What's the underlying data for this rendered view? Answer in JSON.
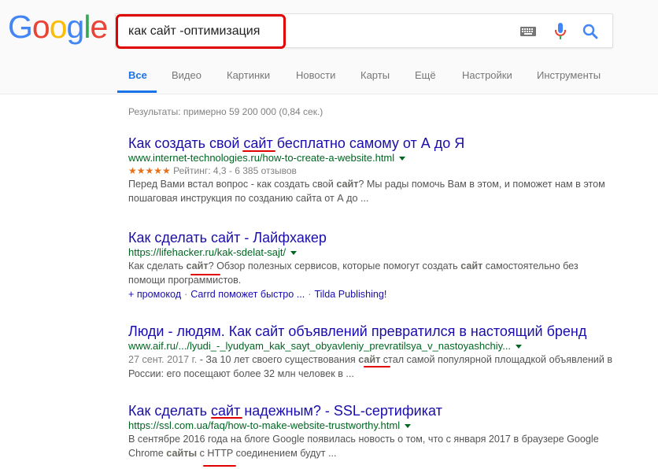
{
  "logo": {
    "letters": [
      "G",
      "o",
      "o",
      "g",
      "l",
      "e"
    ]
  },
  "search": {
    "query": "как сайт -оптимизация"
  },
  "icons": {
    "keyboard": "keyboard-icon",
    "mic": "microphone-icon",
    "search": "search-icon"
  },
  "tabs": [
    {
      "label": "Все",
      "active": true
    },
    {
      "label": "Видео"
    },
    {
      "label": "Картинки"
    },
    {
      "label": "Новости"
    },
    {
      "label": "Карты"
    },
    {
      "label": "Ещё"
    },
    {
      "label": "Настройки"
    },
    {
      "label": "Инструменты"
    }
  ],
  "stats": "Результаты: примерно 59 200 000 (0,84 сек.)",
  "results": [
    {
      "title_parts": [
        "Как создать свой ",
        "сайт",
        " бесплатно самому от А до Я"
      ],
      "url": "www.internet-technologies.ru/how-to-create-a-website.html",
      "rating": {
        "stars": "★★★★★",
        "text": "Рейтинг: 4,3 - 6 385 отзывов",
        "value": 4.3
      },
      "snippet_parts": [
        "Перед Вами встал вопрос - как создать свой ",
        "сайт",
        "? Мы рады помочь Вам в этом, и поможет нам в этом пошаговая инструкция по созданию сайта от А до ..."
      ]
    },
    {
      "title": "Как сделать сайт - Лайфхакер",
      "url": "https://lifehacker.ru/kak-sdelat-sajt/",
      "snippet_parts": [
        "Как сделать ",
        "сайт",
        "? Обзор полезных сервисов, которые помогут создать ",
        "сайт",
        " самостоятельно без помощи программистов."
      ],
      "sitelinks": [
        "+ промокод",
        "Carrd поможет быстро ...",
        "Tilda Publishing!"
      ]
    },
    {
      "title": "Люди - людям. Как сайт объявлений превратился в настоящий бренд",
      "url": "www.aif.ru/.../lyudi_-_lyudyam_kak_sayt_obyavleniy_prevratilsya_v_nastoyashchiy...",
      "date": "27 сент. 2017 г.",
      "snippet_parts": [
        " - За 10 лет своего существования ",
        "сайт",
        " стал самой популярной площадкой объявлений в России: его посещают более 32 млн человек в ..."
      ]
    },
    {
      "title_parts": [
        "Как сделать ",
        "сайт",
        " надежным? - SSL-сертификат"
      ],
      "url": "https://ssl.com.ua/faq/how-to-make-website-trustworthy.html",
      "snippet_parts": [
        "В сентябре 2016 года на блоге Google появилась новость о том, что с января 2017 в браузере Google Chrome ",
        "сайты",
        " с HTTP соединением будут ..."
      ]
    }
  ],
  "colors": {
    "link": "#1a0dab",
    "url": "#006621",
    "annotation_red": "#e00000",
    "active_tab": "#1a73e8"
  }
}
